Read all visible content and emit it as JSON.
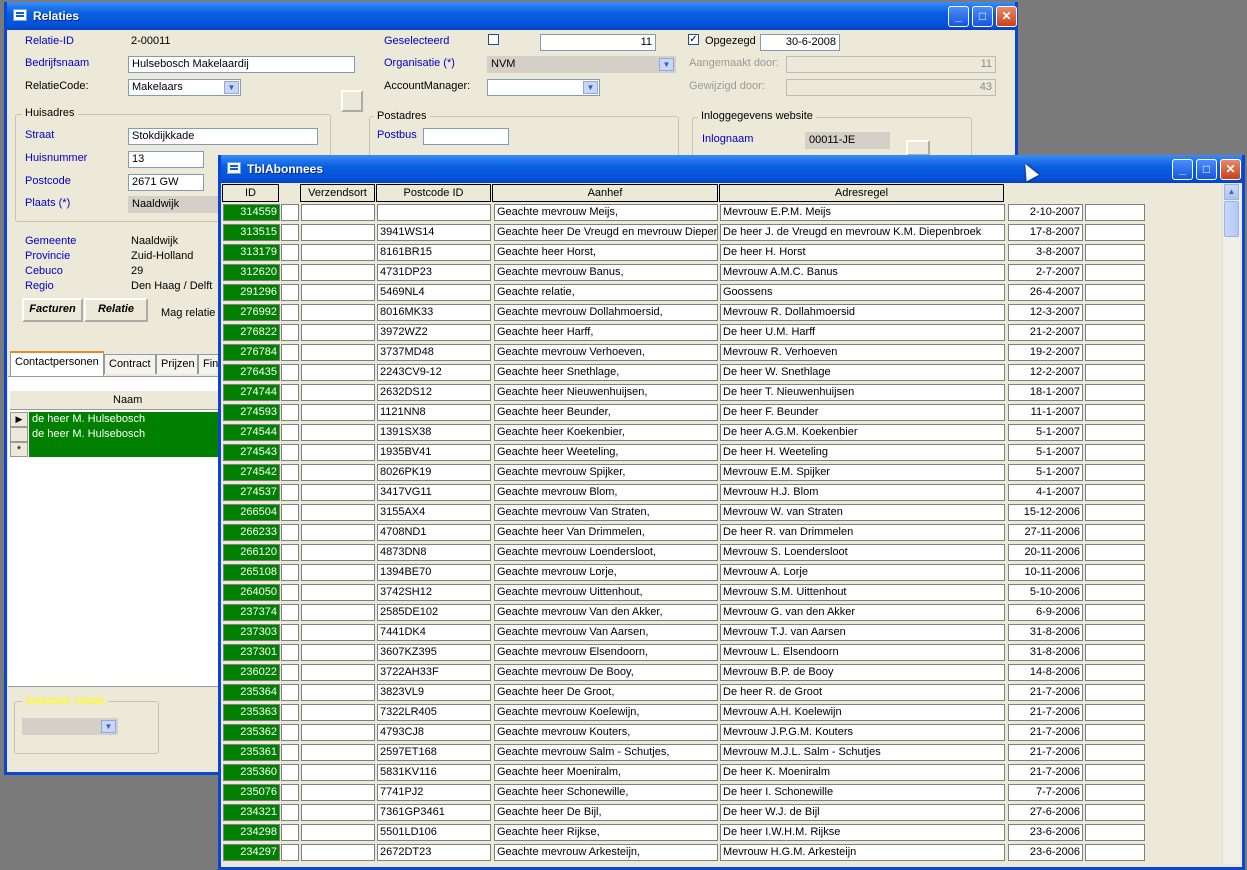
{
  "relaties": {
    "title": "Relaties",
    "relatie_id_label": "Relatie-ID",
    "relatie_id": "2-00011",
    "bedrijfsnaam_label": "Bedrijfsnaam",
    "bedrijfsnaam": "Hulsebosch Makelaardij",
    "relatiecode_label": "RelatieCode:",
    "relatiecode": "Makelaars",
    "geselecteerd_label": "Geselecteerd",
    "geselecteerd_value": "11",
    "opgezegd_label": "Opgezegd",
    "opgezegd_date": "30-6-2008",
    "organisatie_label": "Organisatie (*)",
    "organisatie": "NVM",
    "accountmanager_label": "AccountManager:",
    "aangemaakt_label": "Aangemaakt door:",
    "aangemaakt_value": "11",
    "gewijzigd_label": "Gewijzigd door:",
    "gewijzigd_value": "43",
    "huisadres_label": "Huisadres",
    "straat_label": "Straat",
    "straat": "Stokdijkkade",
    "huisnummer_label": "Huisnummer",
    "huisnummer": "13",
    "postcode_label": "Postcode",
    "postcode": "2671 GW",
    "plaats_label": "Plaats (*)",
    "plaats": "Naaldwijk",
    "postadres_label": "Postadres",
    "postbus_label": "Postbus",
    "inlog_group_label": "Inloggegevens website",
    "inlognaam_label": "Inlognaam",
    "inlognaam": "00011-JE",
    "gemeente_label": "Gemeente",
    "gemeente": "Naaldwijk",
    "provincie_label": "Provincie",
    "provincie": "Zuid-Holland",
    "cebuco_label": "Cebuco",
    "cebuco": "29",
    "regio_label": "Regio",
    "regio": "Den Haag / Delft",
    "facturen_button": "Facturen",
    "relatie_button": "Relatie",
    "mag_relatie_label": "Mag relatie",
    "tabs": [
      "Contactpersonen",
      "Contract",
      "Prijzen",
      "Fin"
    ],
    "sub_header_naam": "Naam",
    "contacts": [
      "de heer M. Hulsebosch",
      "de heer M. Hulsebosch"
    ],
    "new_row_marker": "*",
    "current_row_marker": "▶",
    "selecteer_label": "Selecteer relatie"
  },
  "abonnees": {
    "title": "TblAbonnees",
    "columns": [
      "ID",
      "Verzendsort",
      "Postcode ID",
      "Aanhef",
      "Adresregel"
    ],
    "rows": [
      {
        "id": "314559",
        "postcode": "",
        "aanhef": "Geachte mevrouw Meijs,",
        "adres": "Mevrouw E.P.M. Meijs",
        "date": "2-10-2007"
      },
      {
        "id": "313515",
        "postcode": "3941WS14",
        "aanhef": "Geachte heer De Vreugd en mevrouw Diepent",
        "adres": "De heer J. de Vreugd en mevrouw K.M. Diepenbroek",
        "date": "17-8-2007"
      },
      {
        "id": "313179",
        "postcode": "8161BR15",
        "aanhef": "Geachte heer Horst,",
        "adres": "De heer H. Horst",
        "date": "3-8-2007"
      },
      {
        "id": "312620",
        "postcode": "4731DP23",
        "aanhef": "Geachte mevrouw Banus,",
        "adres": "Mevrouw A.M.C. Banus",
        "date": "2-7-2007"
      },
      {
        "id": "291296",
        "postcode": "5469NL4",
        "aanhef": "Geachte relatie,",
        "adres": "Goossens",
        "date": "26-4-2007"
      },
      {
        "id": "276992",
        "postcode": "8016MK33",
        "aanhef": "Geachte mevrouw Dollahmoersid,",
        "adres": "Mevrouw R. Dollahmoersid",
        "date": "12-3-2007"
      },
      {
        "id": "276822",
        "postcode": "3972WZ2",
        "aanhef": "Geachte heer Harff,",
        "adres": "De heer U.M. Harff",
        "date": "21-2-2007"
      },
      {
        "id": "276784",
        "postcode": "3737MD48",
        "aanhef": "Geachte mevrouw Verhoeven,",
        "adres": "Mevrouw R. Verhoeven",
        "date": "19-2-2007"
      },
      {
        "id": "276435",
        "postcode": "2243CV9-12",
        "aanhef": "Geachte heer Snethlage,",
        "adres": "De heer W. Snethlage",
        "date": "12-2-2007"
      },
      {
        "id": "274744",
        "postcode": "2632DS12",
        "aanhef": "Geachte heer Nieuwenhuijsen,",
        "adres": "De heer T. Nieuwenhuijsen",
        "date": "18-1-2007"
      },
      {
        "id": "274593",
        "postcode": "1121NN8",
        "aanhef": "Geachte heer Beunder,",
        "adres": "De heer F. Beunder",
        "date": "11-1-2007"
      },
      {
        "id": "274544",
        "postcode": "1391SX38",
        "aanhef": "Geachte heer Koekenbier,",
        "adres": "De heer A.G.M. Koekenbier",
        "date": "5-1-2007"
      },
      {
        "id": "274543",
        "postcode": "1935BV41",
        "aanhef": "Geachte heer Weeteling,",
        "adres": "De heer H. Weeteling",
        "date": "5-1-2007"
      },
      {
        "id": "274542",
        "postcode": "8026PK19",
        "aanhef": "Geachte mevrouw Spijker,",
        "adres": "Mevrouw E.M. Spijker",
        "date": "5-1-2007"
      },
      {
        "id": "274537",
        "postcode": "3417VG11",
        "aanhef": "Geachte mevrouw Blom,",
        "adres": "Mevrouw H.J. Blom",
        "date": "4-1-2007"
      },
      {
        "id": "266504",
        "postcode": "3155AX4",
        "aanhef": "Geachte mevrouw Van Straten,",
        "adres": "Mevrouw W. van Straten",
        "date": "15-12-2006"
      },
      {
        "id": "266233",
        "postcode": "4708ND1",
        "aanhef": "Geachte heer Van Drimmelen,",
        "adres": "De heer R. van Drimmelen",
        "date": "27-11-2006"
      },
      {
        "id": "266120",
        "postcode": "4873DN8",
        "aanhef": "Geachte mevrouw Loendersloot,",
        "adres": "Mevrouw S. Loendersloot",
        "date": "20-11-2006"
      },
      {
        "id": "265108",
        "postcode": "1394BE70",
        "aanhef": "Geachte mevrouw Lorje,",
        "adres": "Mevrouw A. Lorje",
        "date": "10-11-2006"
      },
      {
        "id": "264050",
        "postcode": "3742SH12",
        "aanhef": "Geachte mevrouw Uittenhout,",
        "adres": "Mevrouw S.M. Uittenhout",
        "date": "5-10-2006"
      },
      {
        "id": "237374",
        "postcode": "2585DE102",
        "aanhef": "Geachte mevrouw Van den Akker,",
        "adres": "Mevrouw G. van den Akker",
        "date": "6-9-2006"
      },
      {
        "id": "237303",
        "postcode": "7441DK4",
        "aanhef": "Geachte mevrouw Van Aarsen,",
        "adres": "Mevrouw T.J. van Aarsen",
        "date": "31-8-2006"
      },
      {
        "id": "237301",
        "postcode": "3607KZ395",
        "aanhef": "Geachte mevrouw Elsendoorn,",
        "adres": "Mevrouw L. Elsendoorn",
        "date": "31-8-2006"
      },
      {
        "id": "236022",
        "postcode": "3722AH33F",
        "aanhef": "Geachte mevrouw De Booy,",
        "adres": "Mevrouw B.P. de Booy",
        "date": "14-8-2006"
      },
      {
        "id": "235364",
        "postcode": "3823VL9",
        "aanhef": "Geachte heer De Groot,",
        "adres": "De heer R. de Groot",
        "date": "21-7-2006"
      },
      {
        "id": "235363",
        "postcode": "7322LR405",
        "aanhef": "Geachte mevrouw Koelewijn,",
        "adres": "Mevrouw A.H. Koelewijn",
        "date": "21-7-2006"
      },
      {
        "id": "235362",
        "postcode": "4793CJ8",
        "aanhef": "Geachte mevrouw Kouters,",
        "adres": "Mevrouw J.P.G.M. Kouters",
        "date": "21-7-2006"
      },
      {
        "id": "235361",
        "postcode": "2597ET168",
        "aanhef": "Geachte mevrouw Salm - Schutjes,",
        "adres": "Mevrouw M.J.L. Salm - Schutjes",
        "date": "21-7-2006"
      },
      {
        "id": "235360",
        "postcode": "5831KV116",
        "aanhef": "Geachte heer Moeniralm,",
        "adres": "De heer K. Moeniralm",
        "date": "21-7-2006"
      },
      {
        "id": "235076",
        "postcode": "7741PJ2",
        "aanhef": "Geachte heer Schonewille,",
        "adres": "De heer I. Schonewille",
        "date": "7-7-2006"
      },
      {
        "id": "234321",
        "postcode": "7361GP3461",
        "aanhef": "Geachte heer De Bijl,",
        "adres": "De heer W.J. de Bijl",
        "date": "27-6-2006"
      },
      {
        "id": "234298",
        "postcode": "5501LD106",
        "aanhef": "Geachte heer Rijkse,",
        "adres": "De heer I.W.H.M. Rijkse",
        "date": "23-6-2006"
      },
      {
        "id": "234297",
        "postcode": "2672DT23",
        "aanhef": "Geachte mevrouw Arkesteijn,",
        "adres": "Mevrouw H.G.M. Arkesteijn",
        "date": "23-6-2006"
      }
    ]
  },
  "window_controls": {
    "minimize": "_",
    "maximize": "□",
    "close": "✕"
  },
  "colors": {
    "title_blue": "#0a5fe0",
    "id_green": "#008000",
    "form_bg": "#ece9d8"
  }
}
